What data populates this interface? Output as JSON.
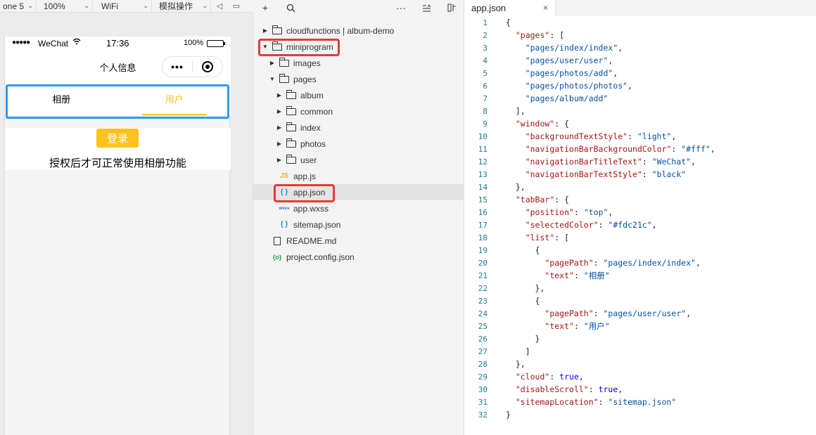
{
  "simulator": {
    "toolbar": {
      "device": "one 5",
      "zoom": "100%",
      "network": "WiFi",
      "operation": "模拟操作"
    },
    "status": {
      "signal": "●●●●●",
      "carrier": "WeChat",
      "time": "17:36",
      "battery": "100%"
    },
    "nav_title": "个人信息",
    "capsule_more": "•••",
    "tabs": [
      {
        "label": "相册",
        "active": false
      },
      {
        "label": "用户",
        "active": true
      }
    ],
    "login_button": "登录",
    "auth_text": "授权后才可正常使用相册功能",
    "accent_color": "#fdc21c",
    "highlight_color": "#2c9bef"
  },
  "explorer": {
    "toolbar": {
      "add": "+",
      "search": "⌕",
      "more": "···"
    },
    "tree": [
      {
        "label": "cloudfunctions | album-demo",
        "type": "folder",
        "expanded": false
      },
      {
        "label": "miniprogram",
        "type": "folder",
        "expanded": true
      },
      {
        "label": "images",
        "type": "folder",
        "expanded": false
      },
      {
        "label": "pages",
        "type": "folder",
        "expanded": true
      },
      {
        "label": "album",
        "type": "folder",
        "expanded": false
      },
      {
        "label": "common",
        "type": "folder",
        "expanded": false
      },
      {
        "label": "index",
        "type": "folder",
        "expanded": false
      },
      {
        "label": "photos",
        "type": "folder",
        "expanded": false
      },
      {
        "label": "user",
        "type": "folder",
        "expanded": false
      },
      {
        "label": "app.js",
        "type": "js",
        "icon_text": "JS"
      },
      {
        "label": "app.json",
        "type": "json",
        "icon_text": "{ }",
        "selected": true
      },
      {
        "label": "app.wxss",
        "type": "wxss",
        "icon_text": "wxss"
      },
      {
        "label": "sitemap.json",
        "type": "json",
        "icon_text": "{ }"
      },
      {
        "label": "README.md",
        "type": "file"
      },
      {
        "label": "project.config.json",
        "type": "config",
        "icon_text": "{o}"
      }
    ],
    "highlight_color": "#e53b36"
  },
  "editor": {
    "tab_title": "app.json",
    "tab_close": "×",
    "lines": [
      {
        "n": "1",
        "text": "{"
      },
      {
        "n": "2",
        "text": "  \"pages\": ["
      },
      {
        "n": "3",
        "text": "    \"pages/index/index\","
      },
      {
        "n": "4",
        "text": "    \"pages/user/user\","
      },
      {
        "n": "5",
        "text": "    \"pages/photos/add\","
      },
      {
        "n": "6",
        "text": "    \"pages/photos/photos\","
      },
      {
        "n": "7",
        "text": "    \"pages/album/add\""
      },
      {
        "n": "8",
        "text": "  ],"
      },
      {
        "n": "9",
        "text": "  \"window\": {"
      },
      {
        "n": "10",
        "text": "    \"backgroundTextStyle\": \"light\","
      },
      {
        "n": "11",
        "text": "    \"navigationBarBackgroundColor\": \"#fff\","
      },
      {
        "n": "12",
        "text": "    \"navigationBarTitleText\": \"WeChat\","
      },
      {
        "n": "13",
        "text": "    \"navigationBarTextStyle\": \"black\""
      },
      {
        "n": "14",
        "text": "  },"
      },
      {
        "n": "15",
        "text": "  \"tabBar\": {"
      },
      {
        "n": "16",
        "text": "    \"position\": \"top\","
      },
      {
        "n": "17",
        "text": "    \"selectedColor\": \"#fdc21c\","
      },
      {
        "n": "18",
        "text": "    \"list\": ["
      },
      {
        "n": "19",
        "text": "      {"
      },
      {
        "n": "20",
        "text": "        \"pagePath\": \"pages/index/index\","
      },
      {
        "n": "21",
        "text": "        \"text\": \"相册\""
      },
      {
        "n": "22",
        "text": "      },"
      },
      {
        "n": "23",
        "text": "      {"
      },
      {
        "n": "24",
        "text": "        \"pagePath\": \"pages/user/user\","
      },
      {
        "n": "25",
        "text": "        \"text\": \"用户\""
      },
      {
        "n": "26",
        "text": "      }"
      },
      {
        "n": "27",
        "text": "    ]"
      },
      {
        "n": "28",
        "text": "  },"
      },
      {
        "n": "29",
        "text": "  \"cloud\": true,"
      },
      {
        "n": "30",
        "text": "  \"disableScroll\": true,"
      },
      {
        "n": "31",
        "text": "  \"sitemapLocation\": \"sitemap.json\""
      },
      {
        "n": "32",
        "text": "}"
      }
    ]
  }
}
